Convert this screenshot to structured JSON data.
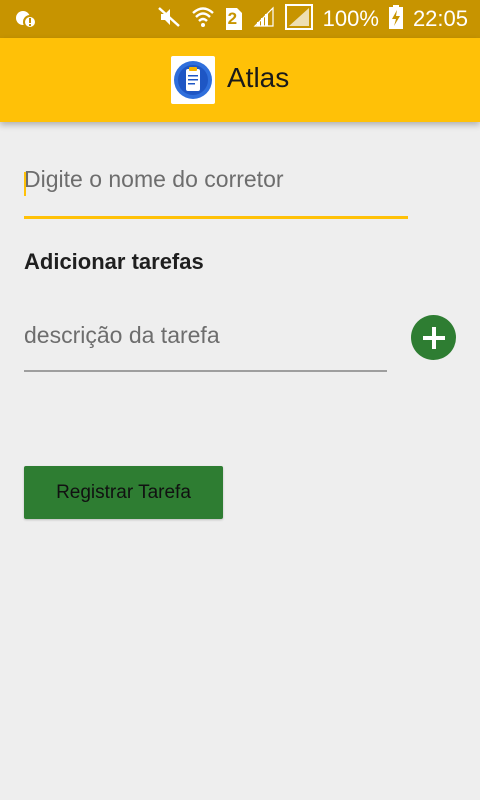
{
  "status_bar": {
    "battery_percent": "100%",
    "time": "22:05",
    "sim_slot": "2",
    "icons": [
      "notification-icon",
      "mute-icon",
      "wifi-icon",
      "sim-icon",
      "signal-icon",
      "signal-empty-icon",
      "battery-charging-icon"
    ]
  },
  "app_bar": {
    "title": "Atlas",
    "logo_icon": "clipboard-badge-icon",
    "color": "#ffc107"
  },
  "form": {
    "broker_placeholder": "Digite o nome do corretor",
    "section_title": "Adicionar tarefas",
    "task_placeholder": "descrição da tarefa",
    "add_icon": "plus-icon",
    "submit_label": "Registrar Tarefa"
  },
  "colors": {
    "status_bar": "#c79400",
    "accent": "#ffc107",
    "primary_green": "#2e7d32",
    "background": "#eeeeee"
  }
}
